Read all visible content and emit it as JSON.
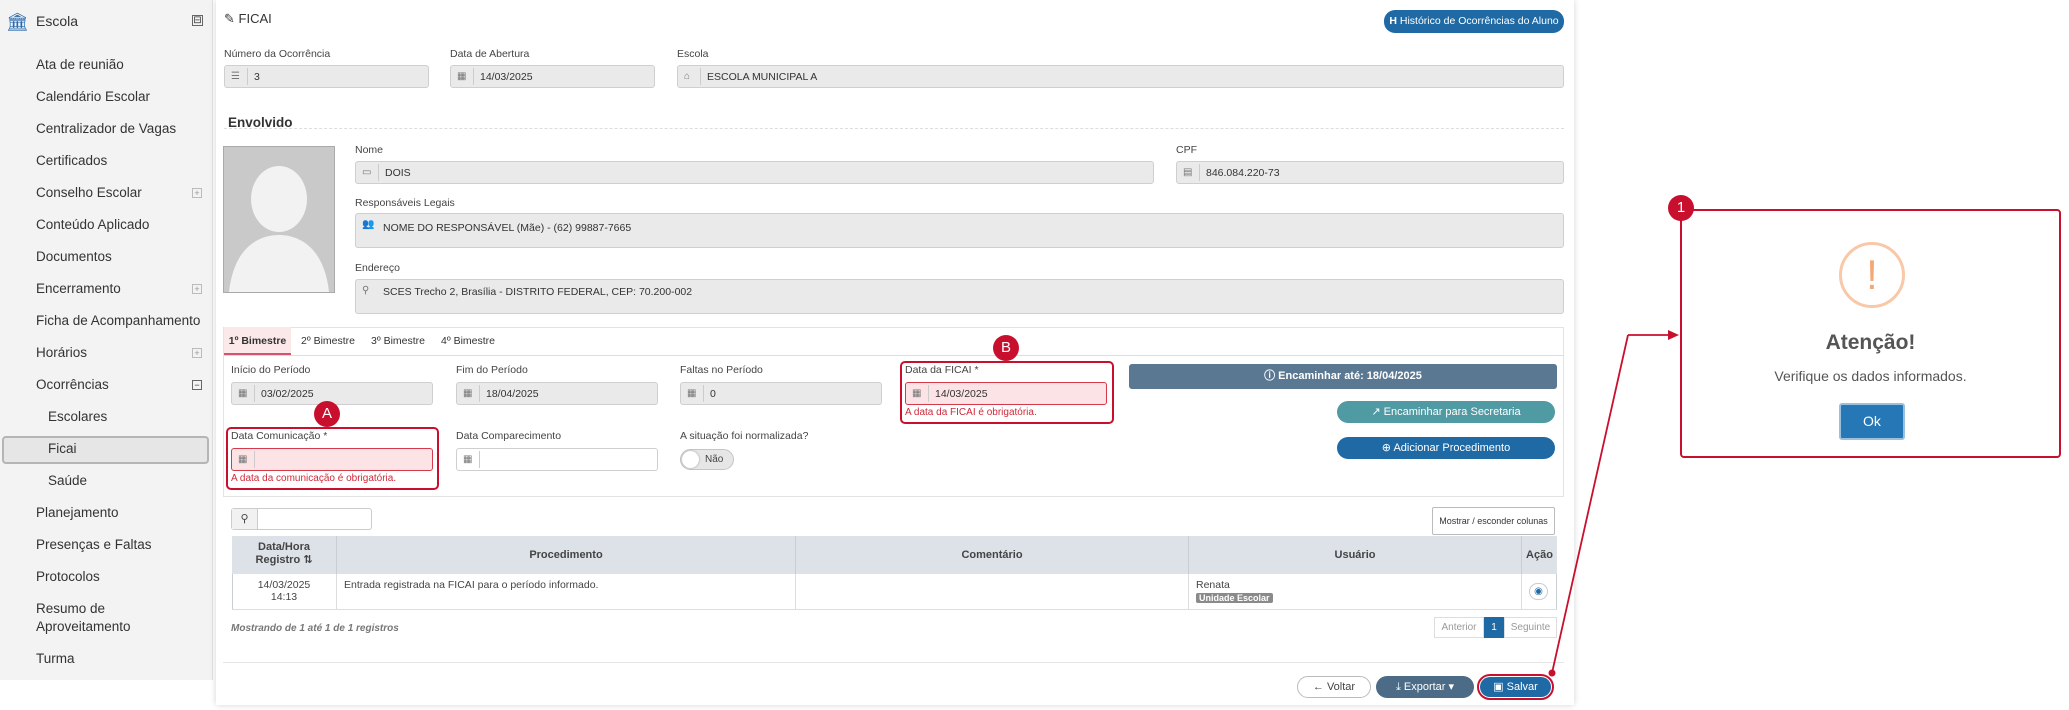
{
  "sidebar": {
    "header": "Escola",
    "toggle": "⊟",
    "items": [
      {
        "label": "Ata de reunião"
      },
      {
        "label": "Calendário Escolar"
      },
      {
        "label": "Centralizador de Vagas"
      },
      {
        "label": "Certificados"
      },
      {
        "label": "Conselho Escolar"
      },
      {
        "label": "Conteúdo Aplicado"
      },
      {
        "label": "Documentos"
      },
      {
        "label": "Encerramento"
      },
      {
        "label": "Ficha de Acompanhamento"
      },
      {
        "label": "Horários"
      },
      {
        "label": "Ocorrências"
      },
      {
        "label": "Escolares"
      },
      {
        "label": "Ficai"
      },
      {
        "label": "Saúde"
      },
      {
        "label": "Planejamento"
      },
      {
        "label": "Presenças e Faltas"
      },
      {
        "label": "Protocolos"
      },
      {
        "label": "Resumo de"
      },
      {
        "label": "Aproveitamento"
      },
      {
        "label": "Turma"
      }
    ]
  },
  "page": {
    "title": "FICAI",
    "history_button": "Histórico de Ocorrências do Aluno",
    "occurrence_number_label": "Número da Ocorrência",
    "occurrence_number": "3",
    "opening_date_label": "Data de Abertura",
    "opening_date": "14/03/2025",
    "school_label": "Escola",
    "school": "ESCOLA MUNICIPAL A"
  },
  "involved": {
    "section_title": "Envolvido",
    "name_label": "Nome",
    "name": "DOIS",
    "cpf_label": "CPF",
    "cpf": "846.084.220-73",
    "guardians_label": "Responsáveis Legais",
    "guardians": "NOME DO RESPONSÁVEL (Mãe) - (62) 99887-7665",
    "address_label": "Endereço",
    "address": "SCES Trecho 2, Brasília - DISTRITO FEDERAL, CEP: 70.200-002"
  },
  "tabs": [
    "1º Bimestre",
    "2º Bimestre",
    "3º Bimestre",
    "4º Bimestre"
  ],
  "period": {
    "start_label": "Início do Período",
    "start": "03/02/2025",
    "end_label": "Fim do Período",
    "end": "18/04/2025",
    "absences_label": "Faltas no Período",
    "absences": "0",
    "ficai_date_label": "Data da FICAI *",
    "ficai_date": "14/03/2025",
    "ficai_error": "A data da FICAI é obrigatória.",
    "forward_until": "Encaminhar até: 18/04/2025",
    "forward_button": "Encaminhar para Secretaria",
    "add_procedure_button": "Adicionar Procedimento",
    "comm_date_label": "Data Comunicação *",
    "comm_date_error": "A data da comunicação é obrigatória.",
    "attendance_date_label": "Data Comparecimento",
    "normalized_label": "A situação foi normalizada?",
    "normalized_value": "Não"
  },
  "table": {
    "columns_toggle": "Mostrar / esconder colunas",
    "headers": {
      "date_line1": "Data/Hora",
      "date_line2": "Registro",
      "procedure": "Procedimento",
      "comment": "Comentário",
      "user": "Usuário",
      "action": "Ação"
    },
    "rows": [
      {
        "date": "14/03/2025",
        "time": "14:13",
        "procedure": "Entrada registrada na FICAI para o período informado.",
        "comment": "",
        "user": "Renata",
        "user_badge": "Unidade Escolar"
      }
    ],
    "info": "Mostrando de 1 até 1 de 1 registros",
    "prev": "Anterior",
    "page": "1",
    "next": "Seguinte"
  },
  "footer": {
    "back": "Voltar",
    "export": "Exportar",
    "save": "Salvar"
  },
  "annotations": {
    "a": "A",
    "b": "B",
    "one": "1"
  },
  "modal": {
    "icon": "!",
    "title": "Atenção!",
    "message": "Verifique os dados informados.",
    "ok": "Ok"
  },
  "colors": {
    "accent": "#1f6aa5",
    "highlight": "#c8102e",
    "teal": "#4f9aa3",
    "slate": "#5b7893"
  }
}
